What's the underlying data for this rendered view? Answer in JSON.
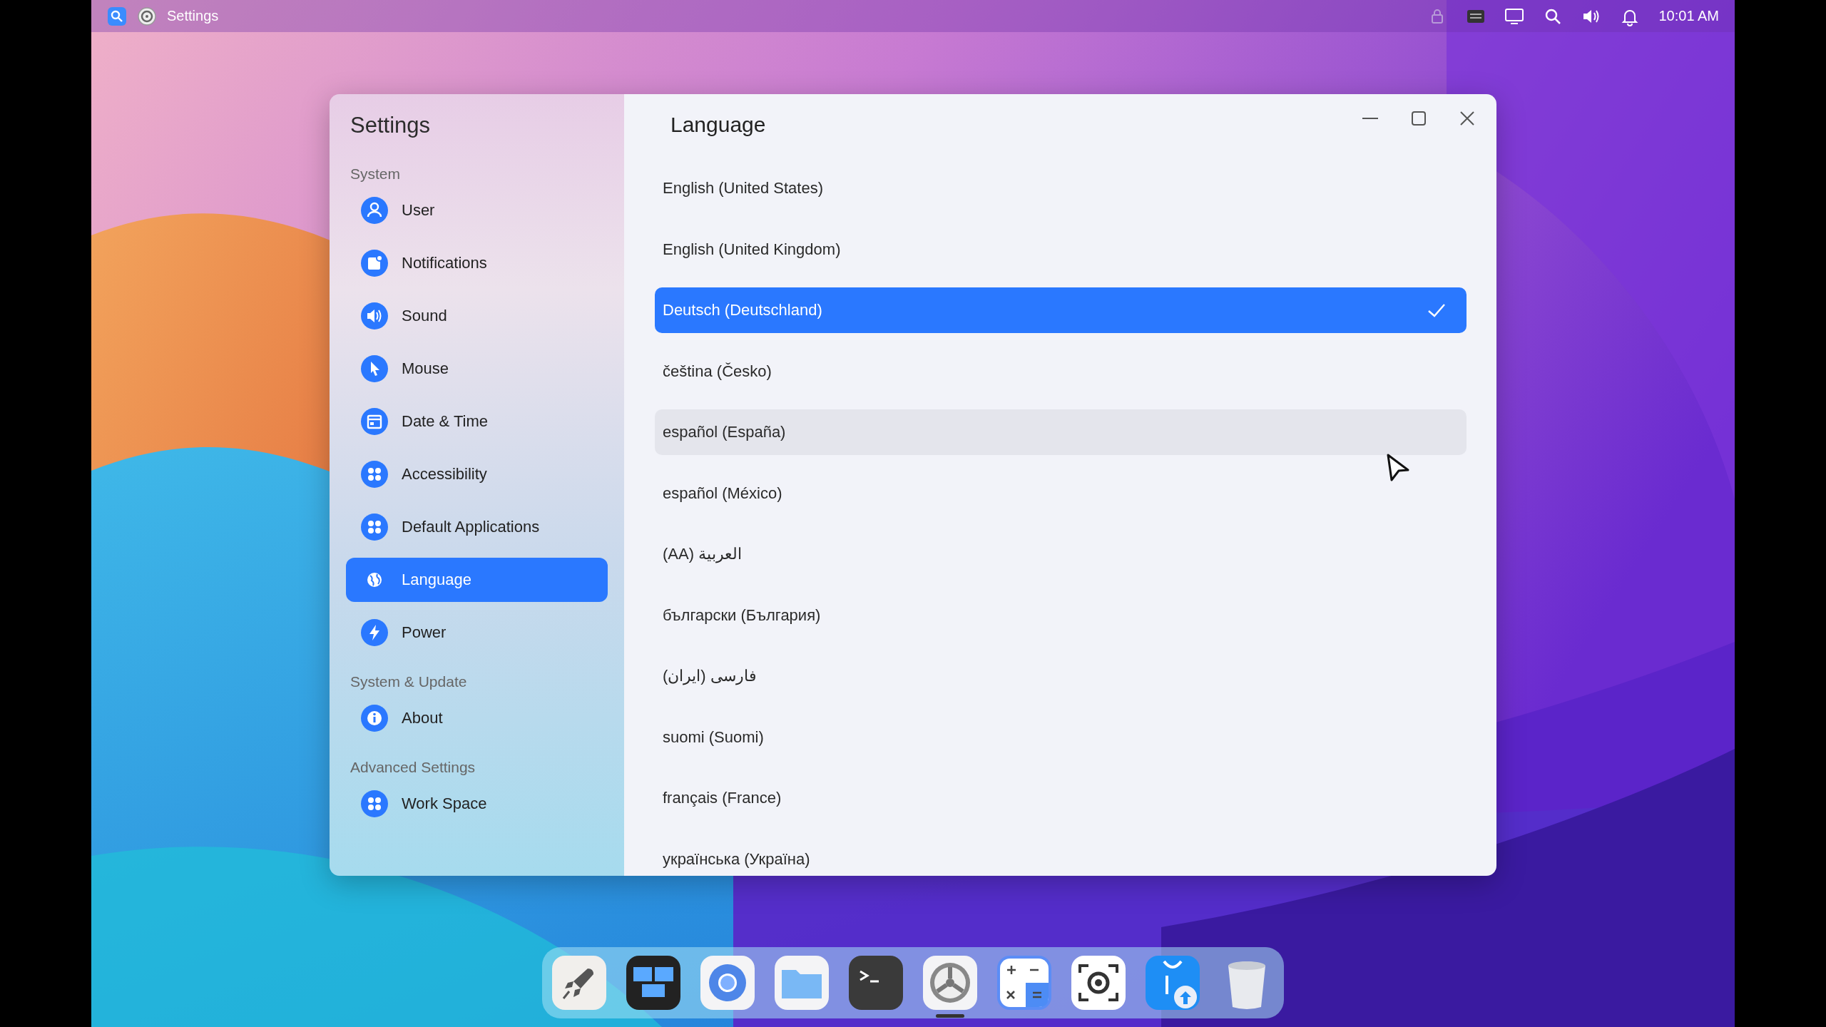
{
  "top_bar": {
    "app_title": "Settings",
    "clock": "10:01 AM"
  },
  "window": {
    "sidebar": {
      "title": "Settings",
      "sections": [
        {
          "label": "System",
          "items": [
            {
              "label": "User",
              "selected": false
            },
            {
              "label": "Notifications",
              "selected": false
            },
            {
              "label": "Sound",
              "selected": false
            },
            {
              "label": "Mouse",
              "selected": false
            },
            {
              "label": "Date & Time",
              "selected": false
            },
            {
              "label": "Accessibility",
              "selected": false
            },
            {
              "label": "Default Applications",
              "selected": false
            },
            {
              "label": "Language",
              "selected": true
            },
            {
              "label": "Power",
              "selected": false
            }
          ]
        },
        {
          "label": "System & Update",
          "items": [
            {
              "label": "About",
              "selected": false
            }
          ]
        },
        {
          "label": "Advanced Settings",
          "items": [
            {
              "label": "Work Space",
              "selected": false
            }
          ]
        }
      ]
    },
    "title": "Language",
    "languages": [
      {
        "label": "English (United States)",
        "selected": false,
        "hovered": false
      },
      {
        "label": "English (United Kingdom)",
        "selected": false,
        "hovered": false
      },
      {
        "label": "Deutsch (Deutschland)",
        "selected": true,
        "hovered": false
      },
      {
        "label": "čeština (Česko)",
        "selected": false,
        "hovered": false
      },
      {
        "label": "español (España)",
        "selected": false,
        "hovered": true
      },
      {
        "label": "español (México)",
        "selected": false,
        "hovered": false
      },
      {
        "label": "العربية (AA)",
        "selected": false,
        "hovered": false
      },
      {
        "label": "български (България)",
        "selected": false,
        "hovered": false
      },
      {
        "label": "فارسی (ایران)",
        "selected": false,
        "hovered": false
      },
      {
        "label": "suomi (Suomi)",
        "selected": false,
        "hovered": false
      },
      {
        "label": "français (France)",
        "selected": false,
        "hovered": false
      },
      {
        "label": "українська (Україна)",
        "selected": false,
        "hovered": false
      }
    ]
  },
  "dock": {
    "apps": [
      {
        "running": false
      },
      {
        "running": false
      },
      {
        "running": false
      },
      {
        "running": false
      },
      {
        "running": false
      },
      {
        "running": true
      },
      {
        "running": false
      },
      {
        "running": false
      },
      {
        "running": false
      },
      {
        "running": false
      }
    ]
  }
}
